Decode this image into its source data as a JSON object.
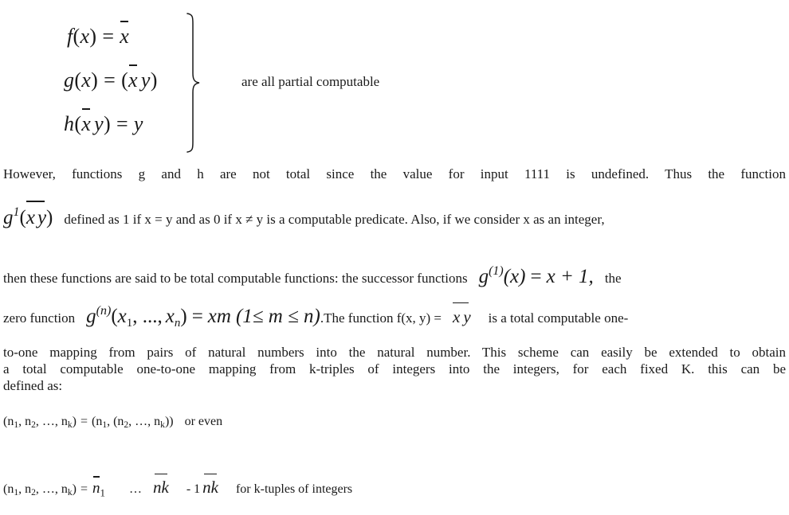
{
  "document": {
    "type": "textbook-page",
    "topic": "partial computable functions"
  },
  "equation_block": {
    "lines": [
      {
        "id": "f",
        "lhs_fn": "f",
        "lhs_open": "(",
        "lhs_var": "x",
        "lhs_close": ")",
        "equals": "=",
        "rhs_var": "x",
        "rhs_overbar": true,
        "plain": "f(x) = x̅"
      },
      {
        "id": "g",
        "lhs_fn": "g",
        "lhs_open": "(",
        "lhs_var": "x",
        "lhs_close": ")",
        "equals": "=",
        "rhs_open": "(",
        "rhs_var1": "x",
        "rhs_var2": "y",
        "rhs_close": ")",
        "rhs_overbar": true,
        "plain": "g(x) = (x̅ y)"
      },
      {
        "id": "h",
        "lhs_fn": "h",
        "lhs_open": "(",
        "lhs_var1": "x",
        "lhs_var2": "y",
        "lhs_close": ")",
        "lhs_overbar": true,
        "equals": "=",
        "rhs_var": "y",
        "plain": "h(x̅ y) = y"
      }
    ],
    "brace": "}",
    "brace_label": "are all partial computable"
  },
  "paragraph_1": {
    "line_1": "However,     functions g and h are not total since the value for input 1111 is undefined. Thus the function",
    "line_2_math_fn": "g",
    "line_2_math_sup": "1",
    "line_2_math_open": "(",
    "line_2_math_var1": "x",
    "line_2_math_var2": "y",
    "line_2_math_close": ")",
    "line_2_text": "defined as 1 if x = y and as 0 if x ≠ y is a computable predicate. Also, if we consider x as an integer,",
    "line_3_text_start": "then these functions are said to be total computable functions: the successor functions",
    "line_3_math_fn": "g",
    "line_3_math_sup": "(1)",
    "line_3_math_arg": "(x)",
    "line_3_math_eq": "=",
    "line_3_math_rhs": "x + 1,",
    "line_3_text_end": "the",
    "line_4_text_start": "zero function",
    "line_4_math_fn": "g",
    "line_4_math_sup": "(n)",
    "line_4_math_args_open": "(",
    "line_4_math_arg1": "x",
    "line_4_math_arg1_sub": "1",
    "line_4_math_sep": ", ...,",
    "line_4_math_arg2": "x",
    "line_4_math_arg2_sub": "n",
    "line_4_math_args_close": ")",
    "line_4_math_eq": "=",
    "line_4_math_rhs": "xm",
    "line_4_math_cond": "(1≤ m ≤ n)",
    "line_4_text_mid": ".The function f(x, y) =",
    "line_4_math_xy_1": "x",
    "line_4_math_xy_2": "y",
    "line_4_text_end": "is a total computable one-"
  },
  "paragraph_2": {
    "line_1": "to-one mapping from pairs of natural numbers into the natural number. This scheme can easily be extended to obtain",
    "line_2": "a total computable one-to-one mapping from k-triples of integers into the integers, for each fixed K. this can be",
    "line_3": "defined as:"
  },
  "tuple_line_1": {
    "lhs": "(n₁, n₂, …, nₖ)",
    "prefix": "(n",
    "sub1": "1",
    "mid1": ", n",
    "sub2": "2",
    "mid2": ", …, n",
    "sub3": "k",
    "close": ")",
    "equals": "=",
    "rhs_open": "(n",
    "rhs_sub1": "1",
    "rhs_mid": ", (n",
    "rhs_sub2": "2",
    "rhs_mid2": ", …, n",
    "rhs_sub3": "k",
    "rhs_close": "))",
    "trailing": "or even",
    "plain": "(n1, n2, …, nk) = (n1, (n2, …, nk)) or even"
  },
  "tuple_line_2": {
    "prefix": "(n",
    "sub1": "1",
    "mid1": ", n",
    "sub2": "2",
    "mid2": ", …, n",
    "sub3": "k",
    "close": ")",
    "equals": "=",
    "m_n1": "n",
    "m_n1_sub": "1",
    "ellipsis": "…",
    "m_nk": "nk",
    "minus_one": "- 1",
    "m_nk2": "nk",
    "trailing": "for k-tuples of integers",
    "plain": "(n1, n2, …, nk) = n̅1 … n̅k - 1 n̅k   for k-tuples of integers"
  },
  "colors": {
    "text": "#1a1a1a",
    "background": "#ffffff"
  }
}
